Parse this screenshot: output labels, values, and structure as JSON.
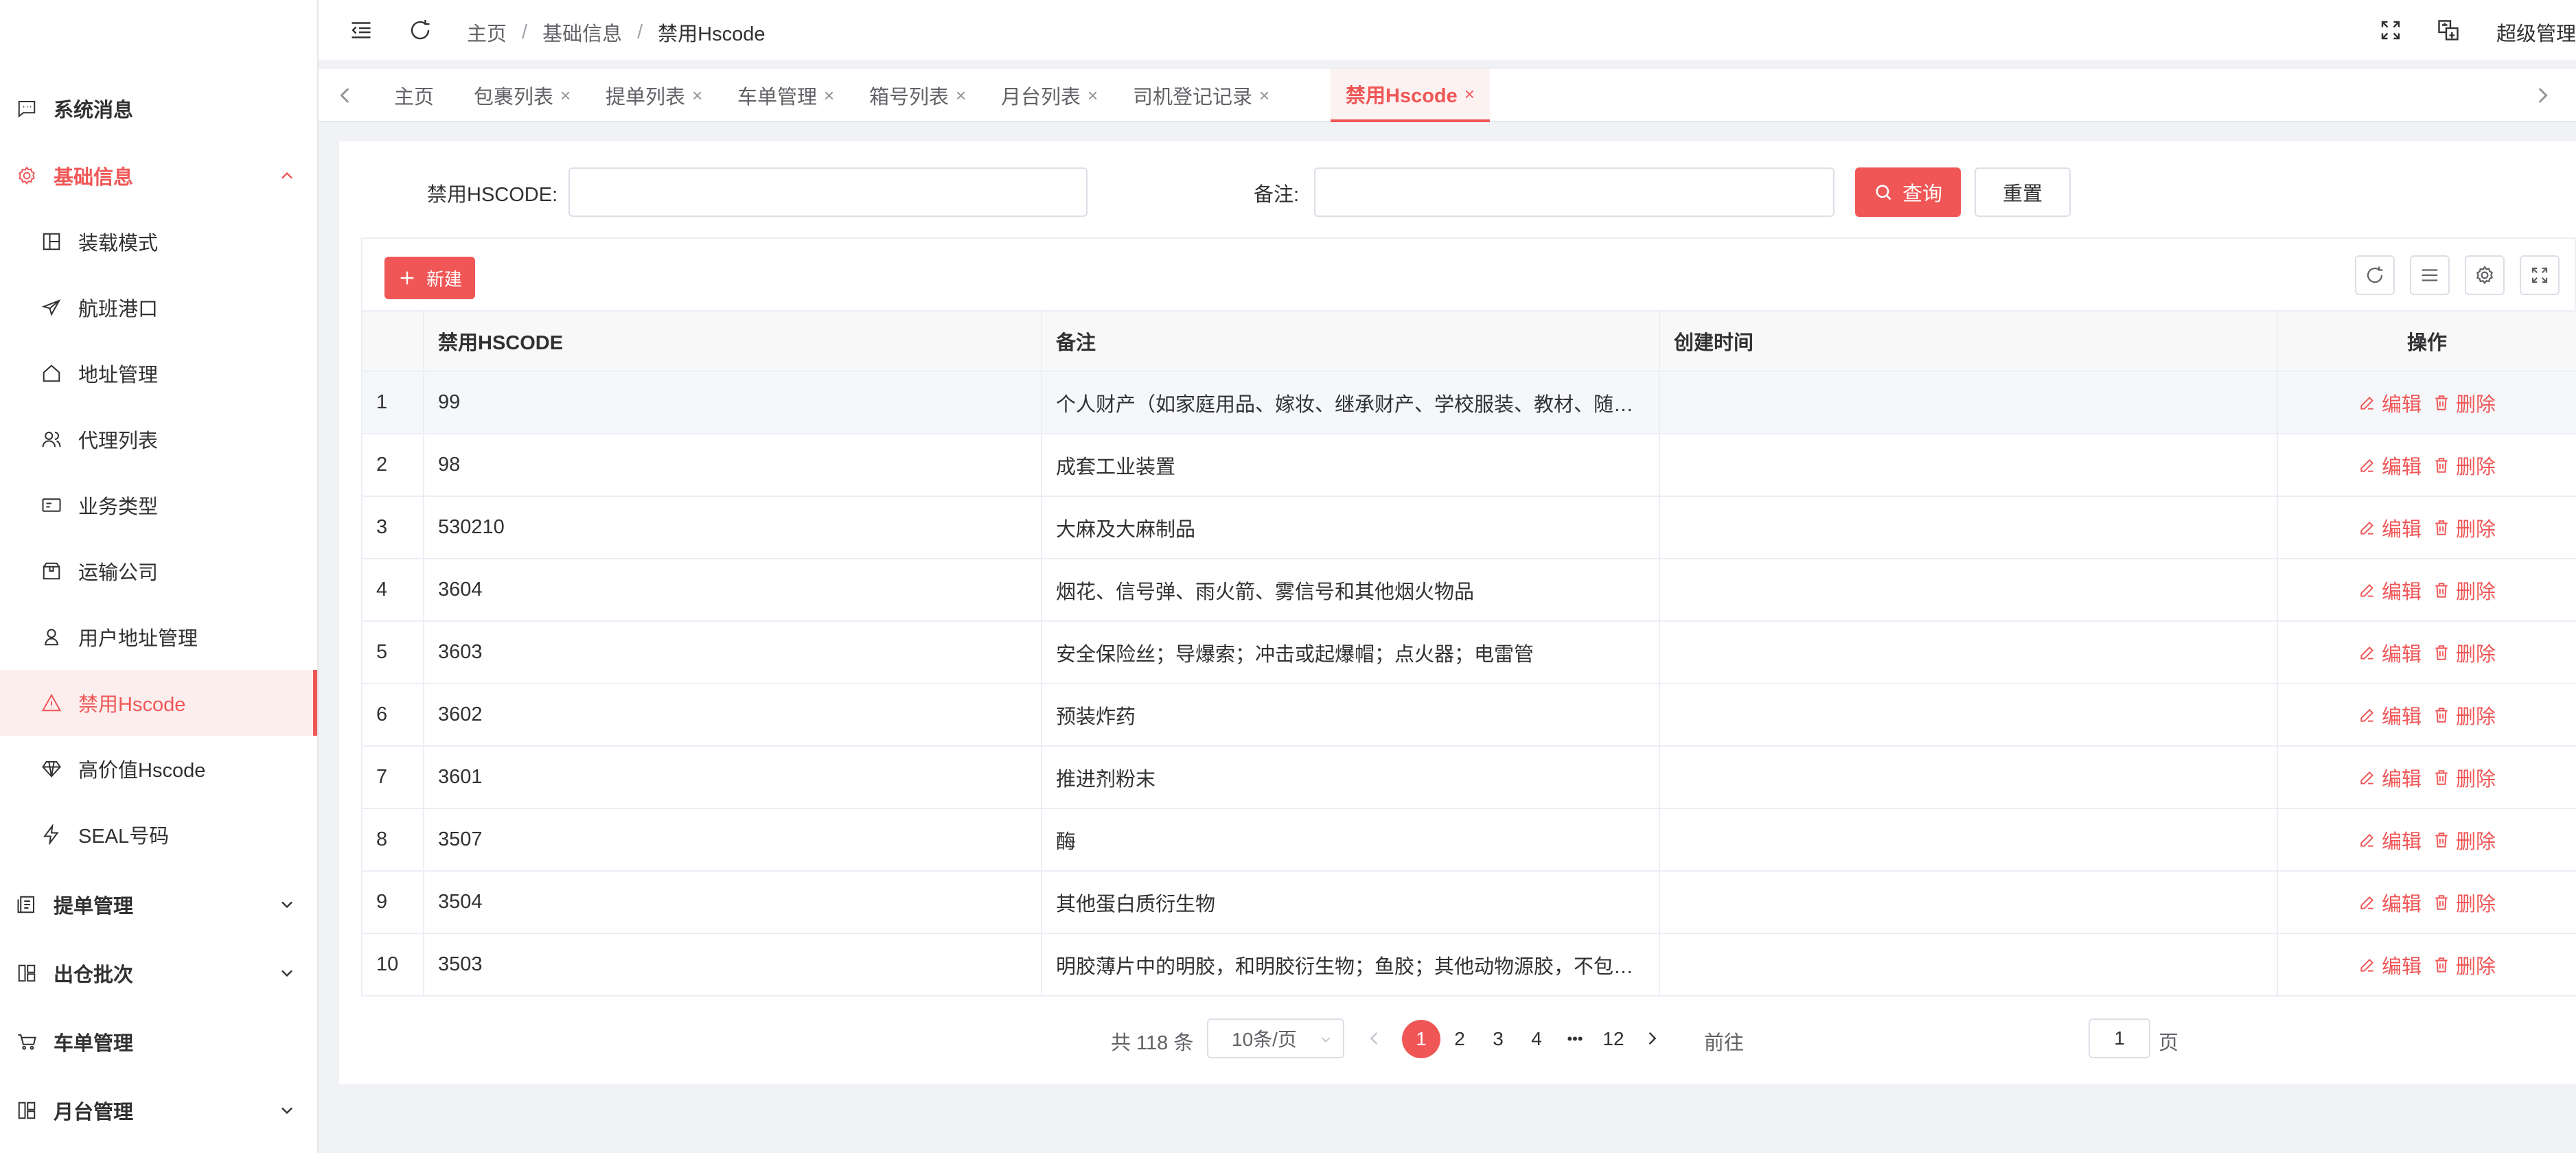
{
  "sidebar": {
    "items": [
      {
        "label": "系统消息"
      },
      {
        "label": "基础信息"
      },
      {
        "label": "装载模式"
      },
      {
        "label": "航班港口"
      },
      {
        "label": "地址管理"
      },
      {
        "label": "代理列表"
      },
      {
        "label": "业务类型"
      },
      {
        "label": "运输公司"
      },
      {
        "label": "用户地址管理"
      },
      {
        "label": "禁用Hscode"
      },
      {
        "label": "高价值Hscode"
      },
      {
        "label": "SEAL号码"
      },
      {
        "label": "提单管理"
      },
      {
        "label": "出仓批次"
      },
      {
        "label": "车单管理"
      },
      {
        "label": "月台管理"
      }
    ]
  },
  "header": {
    "breadcrumb": [
      "主页",
      "基础信息",
      "禁用Hscode"
    ],
    "separator": "/",
    "user": "超级管理"
  },
  "tabs": [
    {
      "label": "主页"
    },
    {
      "label": "包裹列表"
    },
    {
      "label": "提单列表"
    },
    {
      "label": "车单管理"
    },
    {
      "label": "箱号列表"
    },
    {
      "label": "月台列表"
    },
    {
      "label": "司机登记记录"
    },
    {
      "label": "禁用Hscode"
    }
  ],
  "tab_close": "×",
  "filters": {
    "hscode_label": "禁用HSCODE:",
    "hscode_value": "",
    "remark_label": "备注:",
    "remark_value": "",
    "search_button": "查询",
    "reset_button": "重置"
  },
  "toolbar": {
    "new_button": "新建"
  },
  "table": {
    "columns": [
      "",
      "禁用HSCODE",
      "备注",
      "创建时间",
      "操作"
    ],
    "edit_label": "编辑",
    "delete_label": "删除",
    "rows": [
      {
        "index": "1",
        "hscode": "99",
        "remark": "个人财产（如家庭用品、嫁妆、继承财产、学校服装、教材、随葬…",
        "created": ""
      },
      {
        "index": "2",
        "hscode": "98",
        "remark": "成套工业装置",
        "created": ""
      },
      {
        "index": "3",
        "hscode": "530210",
        "remark": "大麻及大麻制品",
        "created": ""
      },
      {
        "index": "4",
        "hscode": "3604",
        "remark": "烟花、信号弹、雨火箭、雾信号和其他烟火物品",
        "created": ""
      },
      {
        "index": "5",
        "hscode": "3603",
        "remark": "安全保险丝；导爆索；冲击或起爆帽；点火器；电雷管",
        "created": ""
      },
      {
        "index": "6",
        "hscode": "3602",
        "remark": "预装炸药",
        "created": ""
      },
      {
        "index": "7",
        "hscode": "3601",
        "remark": "推进剂粉末",
        "created": ""
      },
      {
        "index": "8",
        "hscode": "3507",
        "remark": "酶",
        "created": ""
      },
      {
        "index": "9",
        "hscode": "3504",
        "remark": "其他蛋白质衍生物",
        "created": ""
      },
      {
        "index": "10",
        "hscode": "3503",
        "remark": "明胶薄片中的明胶，和明胶衍生物；鱼胶；其他动物源胶，不包括…",
        "created": ""
      }
    ]
  },
  "pagination": {
    "total": "共 118 条",
    "page_size": "10条/页",
    "pages": [
      "1",
      "2",
      "3",
      "4",
      "•••",
      "12"
    ],
    "current": "1",
    "goto_label": "前往",
    "goto_value": "1",
    "page_unit": "页"
  },
  "colors": {
    "accent": "#f05656",
    "accent_light": "#fdeeee",
    "border": "#ebeef5",
    "background": "#f0f2f5"
  }
}
